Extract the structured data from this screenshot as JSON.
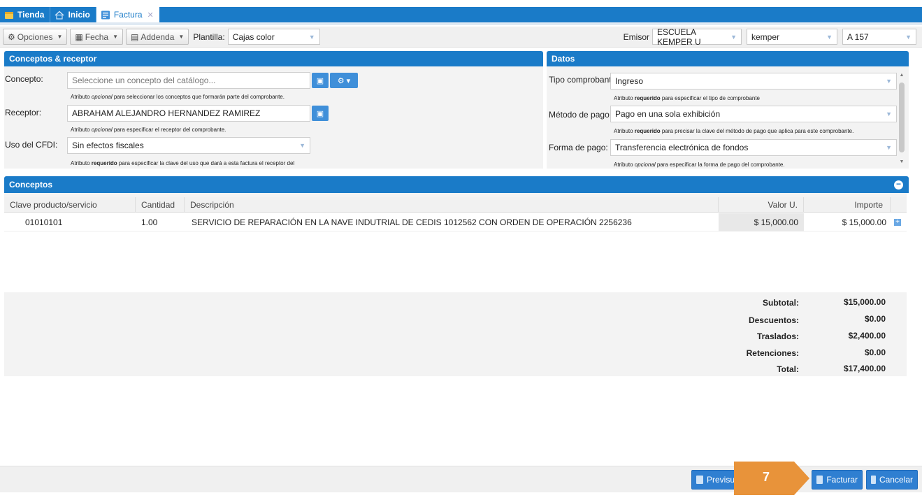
{
  "tabs": [
    {
      "label": "Tienda",
      "icon": "store-icon"
    },
    {
      "label": "Inicio",
      "icon": "home-icon"
    },
    {
      "label": "Factura",
      "icon": "document-icon",
      "active": true
    }
  ],
  "toolbar": {
    "opciones": "Opciones",
    "fecha": "Fecha",
    "addenda": "Addenda",
    "plantilla_label": "Plantilla:",
    "plantilla_value": "Cajas color",
    "emisor_label": "Emisor",
    "emisor_value": "ESCUELA KEMPER U",
    "user_value": "kemper",
    "serie_value": "A 157"
  },
  "conceptos_receptor": {
    "title": "Conceptos & receptor",
    "concepto_label": "Concepto:",
    "concepto_placeholder": "Seleccione un concepto del catálogo...",
    "concepto_hint_pre": "Atributo ",
    "concepto_hint_em": "opcional",
    "concepto_hint_post": " para seleccionar los conceptos que formarán parte del comprobante.",
    "receptor_label": "Receptor:",
    "receptor_value": "ABRAHAM ALEJANDRO HERNANDEZ RAMIREZ",
    "receptor_hint_pre": "Atributo ",
    "receptor_hint_em": "opcional",
    "receptor_hint_post": " para especificar el receptor del comprobante.",
    "uso_label": "Uso del CFDI:",
    "uso_value": "Sin efectos fiscales",
    "uso_hint_pre": "Atributo ",
    "uso_hint_strong": "requerido",
    "uso_hint_post": " para especificar la clave del uso que dará a esta factura el receptor del"
  },
  "datos": {
    "title": "Datos",
    "tipo_label": "Tipo comprobante:",
    "tipo_value": "Ingreso",
    "tipo_hint_pre": "Atributo ",
    "tipo_hint_strong": "requerido",
    "tipo_hint_post": " para especificar el tipo de comprobante",
    "metodo_label": "Método de pago:",
    "metodo_value": "Pago en una sola exhibición",
    "metodo_hint_pre": "Atributo ",
    "metodo_hint_strong": "requerido",
    "metodo_hint_post": " para precisar la clave del método de pago que aplica para este comprobante.",
    "forma_label": "Forma de pago:",
    "forma_value": "Transferencia electrónica de fondos",
    "forma_hint_pre": "Atributo ",
    "forma_hint_em": "opcional",
    "forma_hint_post": " para especificar la forma de pago del comprobante."
  },
  "conceptos": {
    "title": "Conceptos",
    "columns": [
      "Clave producto/servicio",
      "Cantidad",
      "Descripción",
      "Valor U.",
      "Importe"
    ],
    "rows": [
      {
        "clave": "01010101",
        "cantidad": "1.00",
        "descripcion": "SERVICIO DE REPARACIÓN EN LA NAVE INDUTRIAL DE CEDIS 1012562 CON ORDEN DE OPERACIÓN 2256236",
        "valor": "$ 15,000.00",
        "importe": "$ 15,000.00"
      }
    ]
  },
  "totals": {
    "subtotal_label": "Subtotal:",
    "subtotal": "$15,000.00",
    "descuentos_label": "Descuentos:",
    "descuentos": "$0.00",
    "traslados_label": "Traslados:",
    "traslados": "$2,400.00",
    "retenciones_label": "Retenciones:",
    "retenciones": "$0.00",
    "total_label": "Total:",
    "total": "$17,400.00"
  },
  "footer": {
    "previsualizar": "Previsua",
    "facturar": "Facturar",
    "cancelar": "Cancelar",
    "callout_number": "7"
  },
  "colors": {
    "primary": "#1a7bc8",
    "button": "#2f7fd1",
    "callout": "#e8933a"
  }
}
